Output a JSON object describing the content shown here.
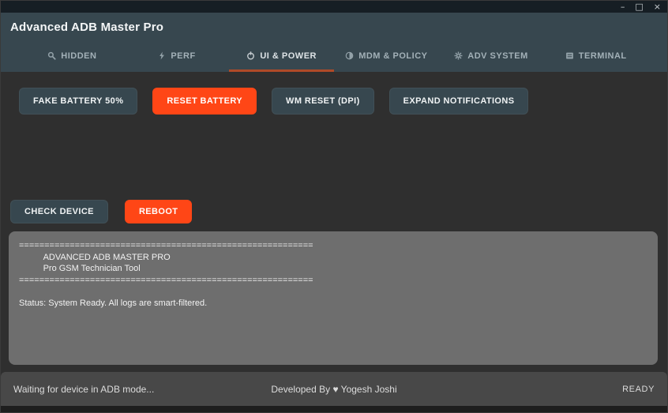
{
  "window": {
    "controls": {
      "minimize": "–",
      "maximize": "□",
      "close": "×"
    }
  },
  "header": {
    "title": "Advanced ADB Master Pro"
  },
  "tabs": [
    {
      "label": "HIDDEN",
      "icon": "search-icon",
      "active": false
    },
    {
      "label": "PERF",
      "icon": "lightning-icon",
      "active": false
    },
    {
      "label": "UI & POWER",
      "icon": "power-icon",
      "active": true
    },
    {
      "label": "MDM & POLICY",
      "icon": "contrast-icon",
      "active": false
    },
    {
      "label": "ADV SYSTEM",
      "icon": "gear-icon",
      "active": false
    },
    {
      "label": "TERMINAL",
      "icon": "terminal-icon",
      "active": false
    }
  ],
  "actions": {
    "row1": [
      {
        "label": "FAKE BATTERY 50%",
        "variant": "dark"
      },
      {
        "label": "RESET BATTERY",
        "variant": "orange"
      },
      {
        "label": "WM RESET (DPI)",
        "variant": "dark"
      },
      {
        "label": "EXPAND NOTIFICATIONS",
        "variant": "dark"
      }
    ],
    "row2": [
      {
        "label": "CHECK DEVICE",
        "variant": "dark"
      },
      {
        "label": "REBOOT",
        "variant": "orange"
      }
    ]
  },
  "log": {
    "text": "==========================================================\n          ADVANCED ADB MASTER PRO\n          Pro GSM Technician Tool\n==========================================================\n\nStatus: System Ready. All logs are smart-filtered."
  },
  "statusbar": {
    "left": "Waiting for device in ADB mode...",
    "center": "Developed By ♥ Yogesh Joshi",
    "right": "READY"
  },
  "colors": {
    "header_bg": "#37474f",
    "content_bg": "#2f2f2f",
    "accent_orange": "#ff4616",
    "tab_underline": "#b04a28",
    "log_bg": "#6e6e6e",
    "statusbar_bg": "#484848"
  }
}
